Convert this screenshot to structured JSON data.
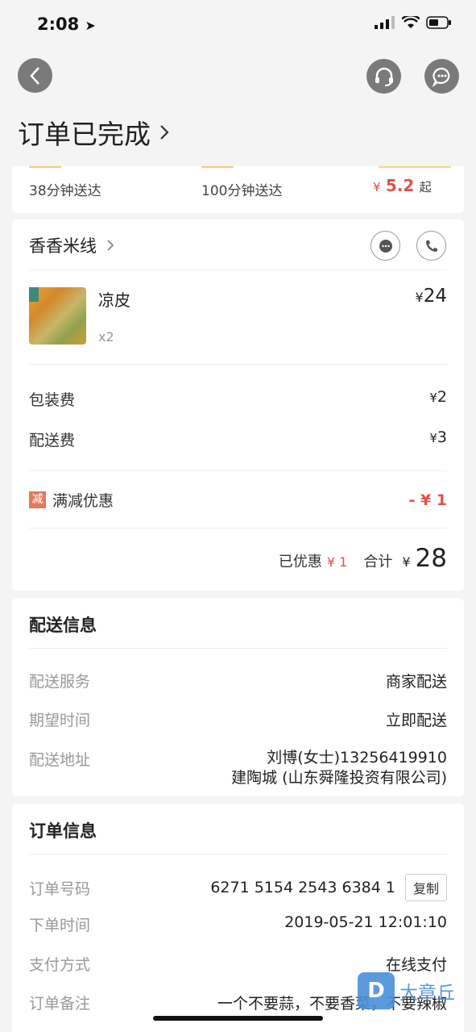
{
  "status_bar": {
    "time": "2:08"
  },
  "header": {
    "title": "订单已完成"
  },
  "partial_card": {
    "items": [
      {
        "text": "38分钟送达"
      },
      {
        "text": "100分钟送达"
      }
    ],
    "price_symbol": "¥",
    "price": "5.2",
    "price_suffix": "起"
  },
  "shop": {
    "name": "香香米线",
    "item": {
      "name": "凉皮",
      "qty": "x2",
      "price": "24"
    },
    "fees": [
      {
        "label": "包装费",
        "value": "2"
      },
      {
        "label": "配送费",
        "value": "3"
      }
    ],
    "discount": {
      "badge": "减",
      "label": "满减优惠",
      "value": "- ¥ 1"
    },
    "saved_label": "已优惠",
    "saved_value": "¥ 1",
    "total_label": "合计",
    "total_value": "28",
    "currency": "¥"
  },
  "delivery": {
    "title": "配送信息",
    "rows": [
      {
        "label": "配送服务",
        "value": "商家配送"
      },
      {
        "label": "期望时间",
        "value": "立即配送"
      }
    ],
    "address_label": "配送地址",
    "address_line1": "刘博(女士)13256419910",
    "address_line2": "建陶城 (山东舜隆投资有限公司)"
  },
  "order": {
    "title": "订单信息",
    "number_label": "订单号码",
    "number_value": "6271 5154 2543 6384 1",
    "copy_label": "复制",
    "time_label": "下单时间",
    "time_value": "2019-05-21 12:01:10",
    "pay_label": "支付方式",
    "pay_value": "在线支付",
    "note_label": "订单备注",
    "note_value": "一个不要蒜，不要香菜，不要辣椒"
  },
  "watermark": {
    "text": "大章丘"
  },
  "colors": {
    "accent_red": "#e5504a",
    "bg": "#f4f4f4"
  }
}
